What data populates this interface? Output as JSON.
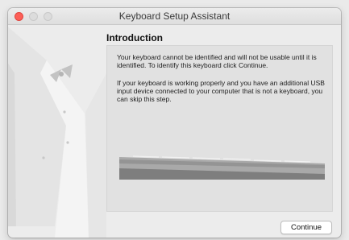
{
  "window": {
    "title": "Keyboard Setup Assistant"
  },
  "content": {
    "heading": "Introduction",
    "paragraph1": "Your keyboard cannot be identified and will not be usable until it is identified. To identify this keyboard click Continue.",
    "paragraph2": "If your keyboard is working properly and you have an additional USB input device connected to your computer that is not a keyboard, you can skip this step."
  },
  "buttons": {
    "continue_label": "Continue"
  },
  "icons": {
    "window_close": "close-icon",
    "window_minimize": "minimize-icon",
    "window_zoom": "zoom-icon",
    "sidebar": "tuxedo-illustration",
    "keyboard": "keyboard-illustration"
  },
  "colors": {
    "close_button": "#fc5f57",
    "window_background": "#ececec",
    "panel_background": "#e1e1e1"
  }
}
